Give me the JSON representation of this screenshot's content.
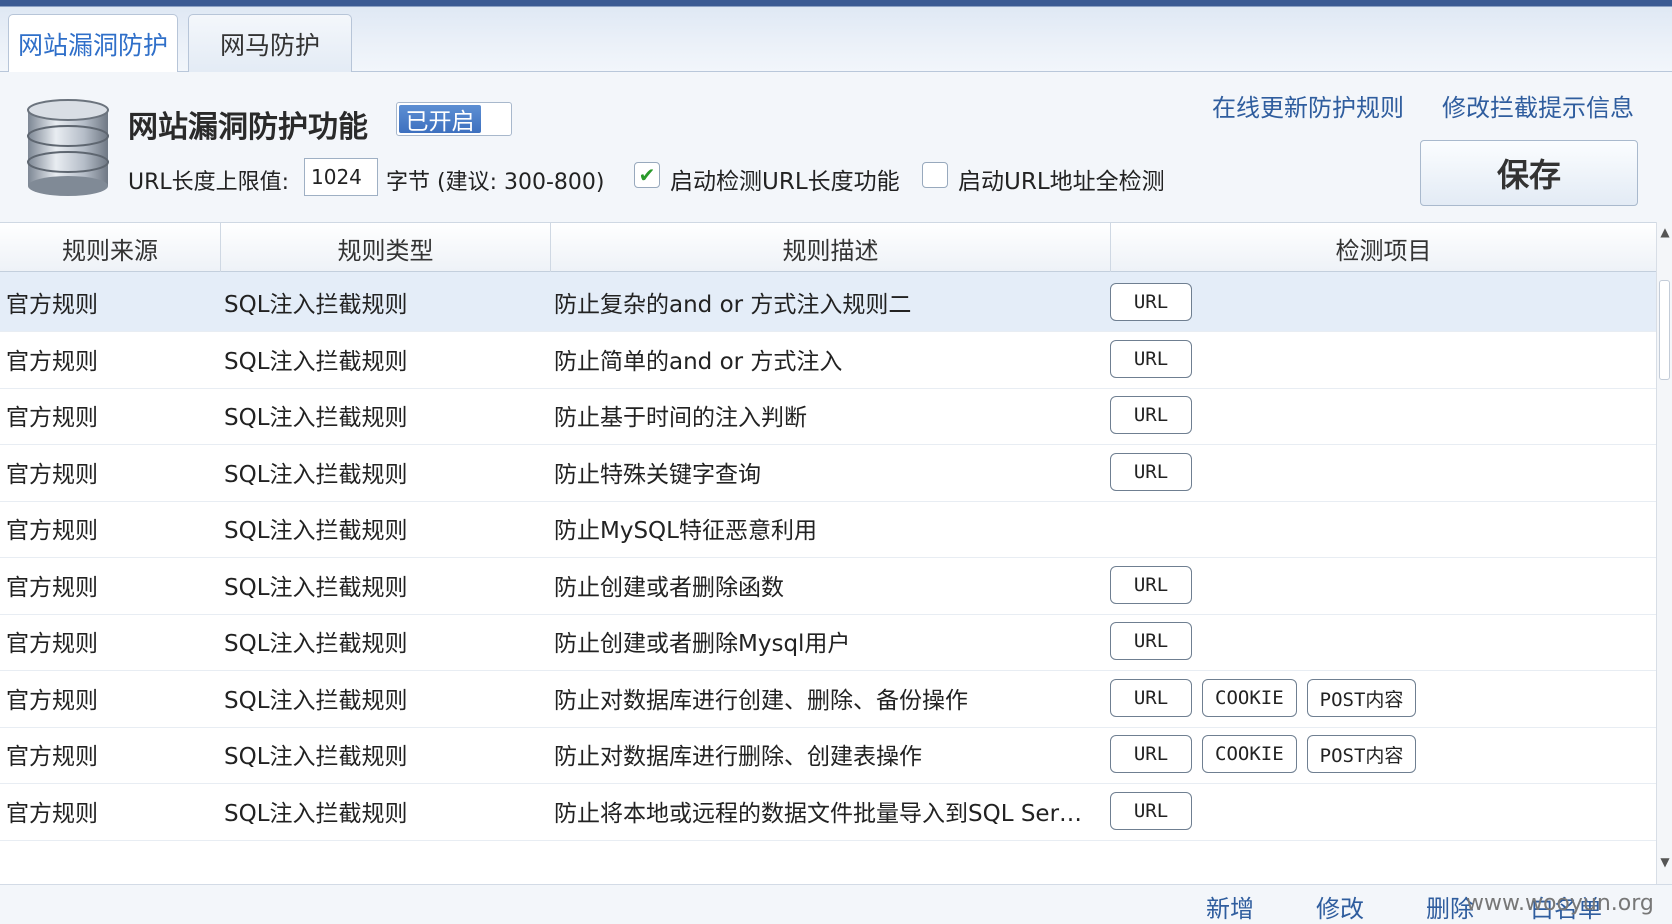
{
  "tabs": [
    {
      "label": "网站漏洞防护"
    },
    {
      "label": "网马防护"
    }
  ],
  "header": {
    "title": "网站漏洞防护功能",
    "toggle_label": "已开启",
    "link_update": "在线更新防护规则",
    "link_modify": "修改拦截提示信息",
    "url_limit_label": "URL长度上限值:",
    "url_limit_value": "1024",
    "url_unit_hint": "字节 (建议: 300-800)",
    "check_url_length_label": "启动检测URL长度功能",
    "check_url_full_label": "启动URL地址全检测",
    "save_label": "保存"
  },
  "table": {
    "headers": [
      "规则来源",
      "规则类型",
      "规则描述",
      "检测项目"
    ],
    "rows": [
      {
        "source": "官方规则",
        "type": "SQL注入拦截规则",
        "desc": "防止复杂的and or 方式注入规则二",
        "items": [
          "URL"
        ]
      },
      {
        "source": "官方规则",
        "type": "SQL注入拦截规则",
        "desc": "防止简单的and or 方式注入",
        "items": [
          "URL"
        ]
      },
      {
        "source": "官方规则",
        "type": "SQL注入拦截规则",
        "desc": "防止基于时间的注入判断",
        "items": [
          "URL"
        ]
      },
      {
        "source": "官方规则",
        "type": "SQL注入拦截规则",
        "desc": "防止特殊关键字查询",
        "items": [
          "URL"
        ]
      },
      {
        "source": "官方规则",
        "type": "SQL注入拦截规则",
        "desc": "防止MySQL特征恶意利用",
        "items": []
      },
      {
        "source": "官方规则",
        "type": "SQL注入拦截规则",
        "desc": "防止创建或者删除函数",
        "items": [
          "URL"
        ]
      },
      {
        "source": "官方规则",
        "type": "SQL注入拦截规则",
        "desc": "防止创建或者删除Mysql用户",
        "items": [
          "URL"
        ]
      },
      {
        "source": "官方规则",
        "type": "SQL注入拦截规则",
        "desc": "防止对数据库进行创建、删除、备份操作",
        "items": [
          "URL",
          "COOKIE",
          "POST内容"
        ]
      },
      {
        "source": "官方规则",
        "type": "SQL注入拦截规则",
        "desc": "防止对数据库进行删除、创建表操作",
        "items": [
          "URL",
          "COOKIE",
          "POST内容"
        ]
      },
      {
        "source": "官方规则",
        "type": "SQL注入拦截规则",
        "desc": "防止将本地或远程的数据文件批量导入到SQL Ser…",
        "items": [
          "URL"
        ]
      }
    ]
  },
  "footer": {
    "add": "新增",
    "edit": "修改",
    "delete": "删除",
    "whitelist": "白名单",
    "watermark": "www.wooyun.org"
  },
  "icons": {
    "database": "database-icon",
    "checkmark": "checkmark-icon"
  },
  "colors": {
    "accent_blue": "#2f6fc9",
    "link_blue": "#2f5d9e",
    "toggle_on": "#4a7cc8",
    "check_green": "#2a9a2a"
  }
}
